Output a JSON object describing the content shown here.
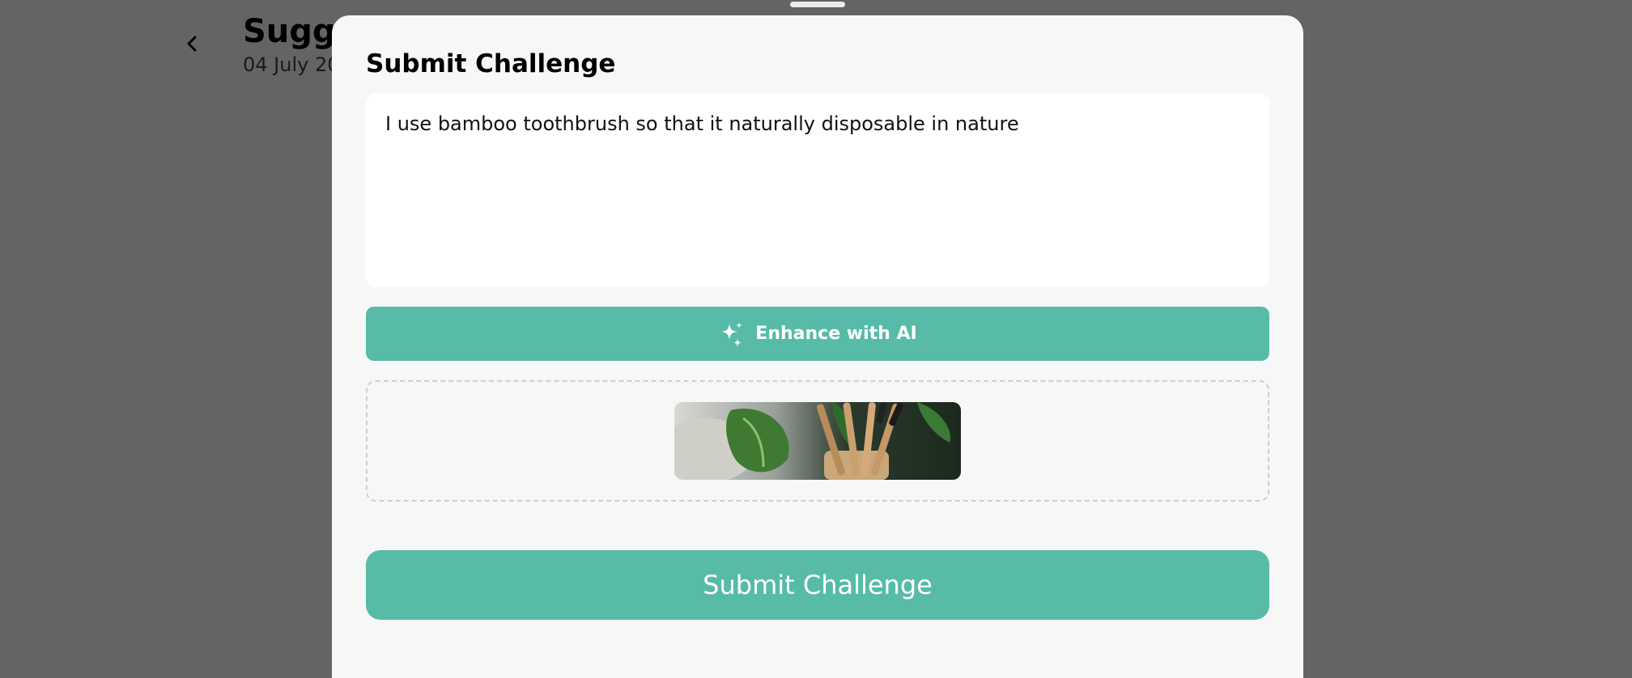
{
  "background": {
    "title": "Sugge",
    "date": "04 July 20",
    "back_icon": "chevron-left-icon"
  },
  "sheet": {
    "title": "Submit Challenge",
    "textarea_value": "I use bamboo toothbrush so that it naturally disposable in nature",
    "enhance_label": "Enhance with AI",
    "enhance_icon": "sparkles-icon",
    "submit_label": "Submit Challenge"
  },
  "colors": {
    "accent": "#57bba7",
    "overlay": "#646464",
    "sheet_bg": "#f7f7f7"
  }
}
